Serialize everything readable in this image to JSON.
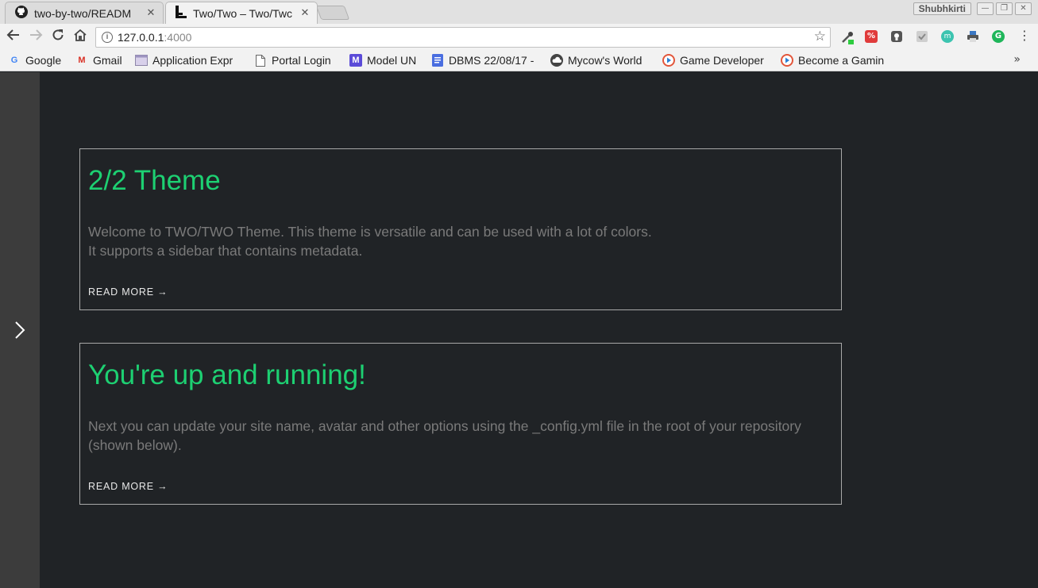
{
  "browser": {
    "tabs": [
      {
        "title": "two-by-two/READM",
        "close": "✕",
        "active": false
      },
      {
        "title": "Two/Two – Two/Twc",
        "close": "✕",
        "active": true
      }
    ],
    "profile_name": "Shubhkirti",
    "window_buttons": {
      "minimize": "—",
      "maximize": "❐",
      "close": "✕"
    },
    "address": {
      "host": "127.0.0.1",
      "port": ":4000"
    },
    "bookmarks": [
      {
        "label": "Google",
        "icon": "google-icon"
      },
      {
        "label": "Gmail",
        "icon": "gmail-icon"
      },
      {
        "label": "Application Expr",
        "icon": "folder-icon"
      },
      {
        "label": "Portal Login",
        "icon": "page-icon"
      },
      {
        "label": "Model UN",
        "icon": "model-un-icon"
      },
      {
        "label": "DBMS 22/08/17 -",
        "icon": "docs-icon"
      },
      {
        "label": "Mycow's World",
        "icon": "cloud-icon"
      },
      {
        "label": "Game Developer",
        "icon": "play-icon"
      },
      {
        "label": "Become a Gamin",
        "icon": "play-icon"
      }
    ],
    "bookmarks_more": "»"
  },
  "posts": [
    {
      "title": "2/2 Theme",
      "body": [
        "Welcome to TWO/TWO Theme. This theme is versatile and can be used with a lot of colors.",
        "It supports a sidebar that contains metadata."
      ],
      "read_more": "READ MORE →"
    },
    {
      "title": "You're up and running!",
      "body": [
        "Next you can update your site name, avatar and other options using the _config.yml file in the root of your repository (shown below)."
      ],
      "read_more": "READ MORE →"
    }
  ],
  "colors": {
    "accent": "#1dd072",
    "page_bg": "#202326",
    "sidebar_bg": "#3c3c3c",
    "body_text": "#7a7a7a"
  }
}
